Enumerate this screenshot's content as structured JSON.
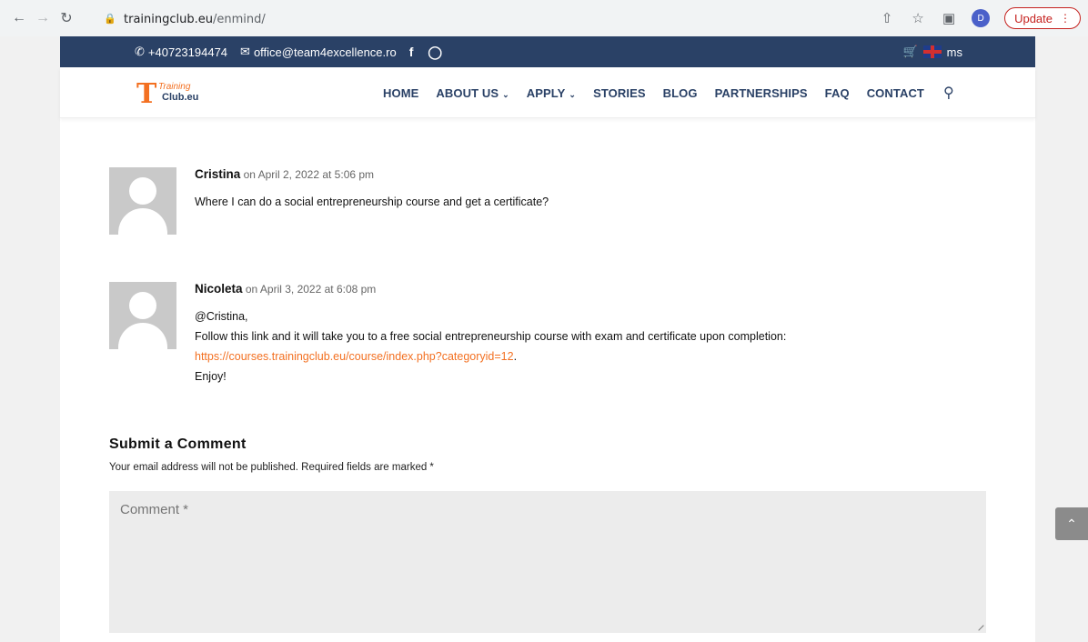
{
  "browser": {
    "url_domain": "trainingclub.eu",
    "url_path": "/enmind/",
    "profile_initial": "D",
    "update_label": "Update"
  },
  "topbar": {
    "phone": "+40723194474",
    "email": "office@team4excellence.ro",
    "social_facebook": "f",
    "cart_label": "ms"
  },
  "logo": {
    "letter": "T",
    "line1": "Training",
    "line2": "Club.eu"
  },
  "menu": {
    "items": [
      "HOME",
      "ABOUT US",
      "APPLY",
      "STORIES",
      "BLOG",
      "PARTNERSHIPS",
      "FAQ",
      "CONTACT"
    ]
  },
  "comments": [
    {
      "author": "Cristina",
      "date": "on April 2, 2022 at 5:06 pm",
      "lines": [
        "Where I can do a social entrepreneurship course and get a certificate?"
      ]
    },
    {
      "author": "Nicoleta",
      "date": "on April 3, 2022 at 6:08 pm",
      "line1": "@Cristina,",
      "line2": "Follow this link and it will take you to a free social entrepreneurship course with exam and certificate upon completion:",
      "link": "https://courses.trainingclub.eu/course/index.php?categoryid=12",
      "link_suffix": ".",
      "line3": "Enjoy!"
    }
  ],
  "form": {
    "title": "Submit a Comment",
    "note": "Your email address will not be published. Required fields are marked *",
    "comment_placeholder": "Comment *"
  }
}
